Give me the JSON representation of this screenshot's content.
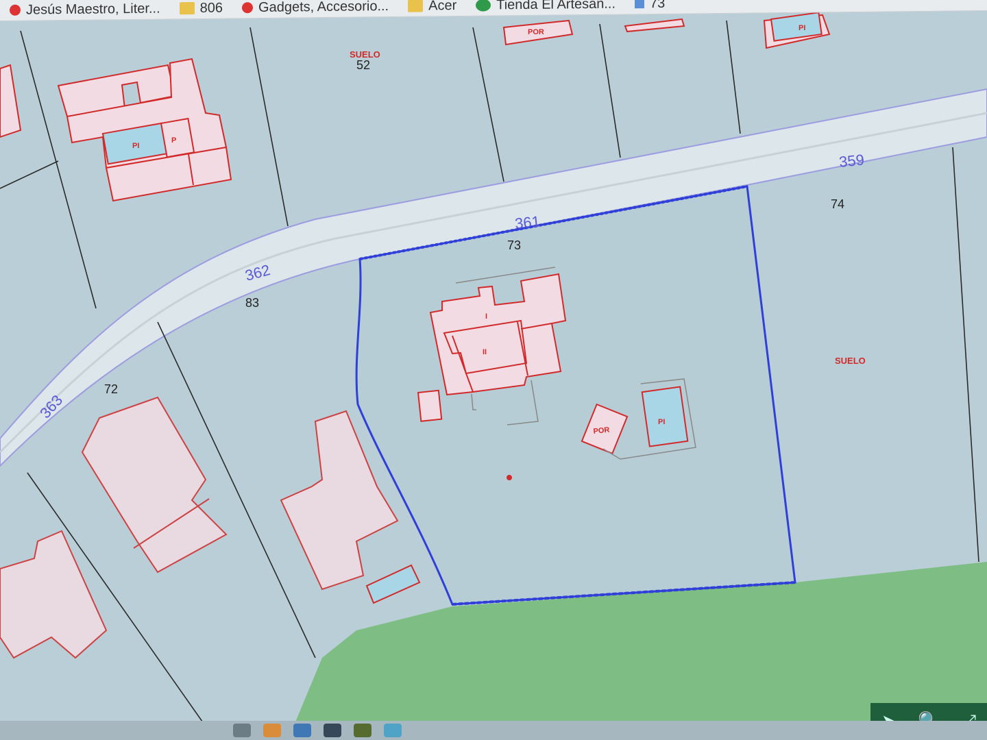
{
  "bookmarks": [
    {
      "label": "Jesús Maestro, Liter...",
      "icon": "pin-icon"
    },
    {
      "label": "806",
      "icon": "folder-icon"
    },
    {
      "label": "Gadgets, Accesorio...",
      "icon": "pin-icon"
    },
    {
      "label": "Acer",
      "icon": "folder-icon"
    },
    {
      "label": "Tienda El Artesan...",
      "icon": "green-icon"
    },
    {
      "label": "73",
      "icon": "blue-icon"
    }
  ],
  "parcels": {
    "p52": "52",
    "p73": "73",
    "p74": "74",
    "p83": "83",
    "p72": "72"
  },
  "roads": {
    "r359": "359",
    "r361": "361",
    "r362": "362",
    "r363": "363"
  },
  "building_labels": {
    "suelo_top": "SUELO",
    "suelo_right": "SUELO",
    "por_top": "POR",
    "por_main": "POR",
    "pi_top": "PI",
    "pi_left": "PI",
    "pi_main": "PI",
    "i": "I",
    "ii": "II",
    "p": "P"
  },
  "colors": {
    "parcel_fill": "#b9ced6",
    "road_fill": "#dde6ea",
    "building_fill": "#f2dbe2",
    "building_stroke": "#d12a2a",
    "pool_fill": "#a9d6e6",
    "selected_boundary": "#2f3fd8",
    "green_area": "#7ebd84"
  },
  "tools": {
    "arrow": "➤",
    "zoom": "🔍",
    "pan": "⤢"
  }
}
